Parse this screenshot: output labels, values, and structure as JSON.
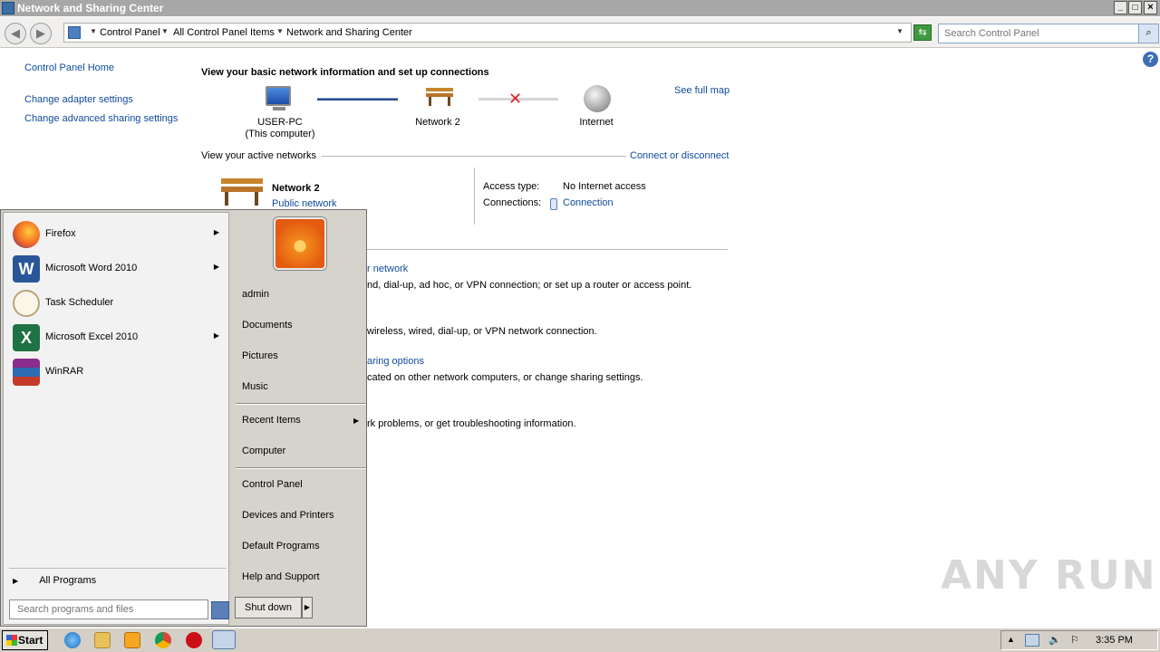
{
  "window": {
    "title": "Network and Sharing Center",
    "controls": [
      "_",
      "□",
      "×"
    ]
  },
  "address": {
    "breadcrumbs": [
      "Control Panel",
      "All Control Panel Items",
      "Network and Sharing Center"
    ],
    "search_placeholder": "Search Control Panel"
  },
  "left_pane": {
    "home": "Control Panel Home",
    "links": [
      "Change adapter settings",
      "Change advanced sharing settings"
    ]
  },
  "main": {
    "heading": "View your basic network information and set up connections",
    "see_full_map": "See full map",
    "map": {
      "computer_name": "USER-PC",
      "computer_sub": "(This computer)",
      "network": "Network  2",
      "internet": "Internet"
    },
    "active_networks_label": "View your active networks",
    "connect_link": "Connect or disconnect",
    "active_network": {
      "name": "Network  2",
      "type": "Public network",
      "access_type_label": "Access type:",
      "access_type_value": "No Internet access",
      "connections_label": "Connections:",
      "connections_value": "Connection"
    },
    "partial_texts": {
      "t1": "r network",
      "t2": "nd, dial-up, ad hoc, or VPN connection; or set up a router or access point.",
      "t3": "wireless, wired, dial-up, or VPN network connection.",
      "t4": "aring options",
      "t5": "cated on other network computers, or change sharing settings.",
      "t6": "rk problems, or get troubleshooting information."
    }
  },
  "start_menu": {
    "programs": [
      {
        "label": "Firefox",
        "icon": "firefox-icon",
        "has_submenu": true
      },
      {
        "label": "Microsoft Word 2010",
        "icon": "word-icon",
        "has_submenu": true
      },
      {
        "label": "Task Scheduler",
        "icon": "clock-icon",
        "has_submenu": false
      },
      {
        "label": "Microsoft Excel 2010",
        "icon": "excel-icon",
        "has_submenu": true
      },
      {
        "label": "WinRAR",
        "icon": "winrar-icon",
        "has_submenu": false
      }
    ],
    "all_programs": "All Programs",
    "search_placeholder": "Search programs and files",
    "right_items": {
      "user": "admin",
      "documents": "Documents",
      "pictures": "Pictures",
      "music": "Music",
      "recent": "Recent Items",
      "computer": "Computer",
      "control_panel": "Control Panel",
      "devices": "Devices and Printers",
      "default_programs": "Default Programs",
      "help": "Help and Support"
    },
    "shutdown": "Shut down"
  },
  "taskbar": {
    "start_label": "Start",
    "clock": "3:35 PM"
  },
  "watermark": "ANY RUN",
  "colors": {
    "link": "#0e4a9e",
    "map_connected": "#2b4a8f",
    "map_error": "#d9232a"
  }
}
